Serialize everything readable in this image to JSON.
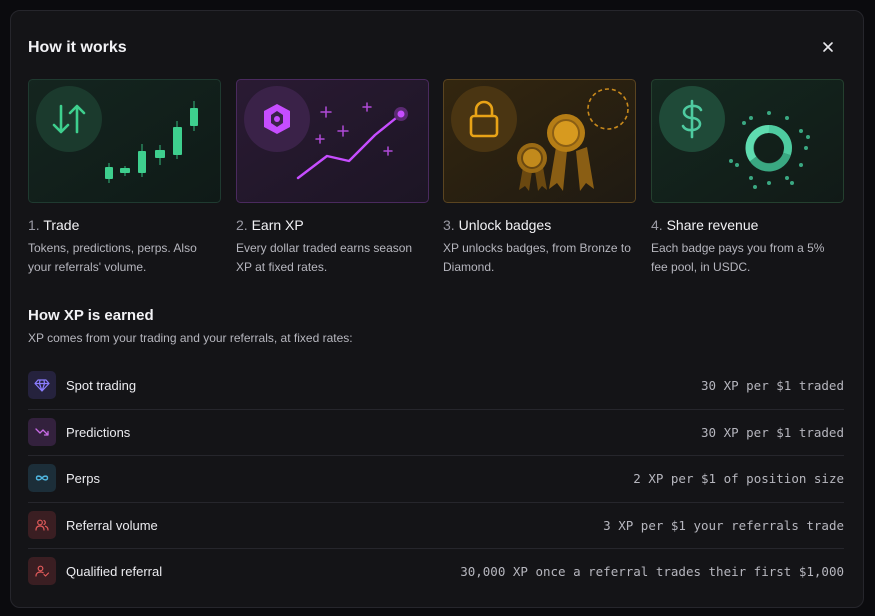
{
  "modal": {
    "title": "How it works",
    "close_icon": "close-icon"
  },
  "steps": [
    {
      "number": "1.",
      "title": "Trade",
      "description": "Tokens, predictions, perps. Also your referrals' volume.",
      "icon": "swap-arrows-icon",
      "accent": "#3ecf8e"
    },
    {
      "number": "2.",
      "title": "Earn XP",
      "description": "Every dollar traded earns season XP at fixed rates.",
      "icon": "gem-icon",
      "accent": "#c64dff"
    },
    {
      "number": "3.",
      "title": "Unlock badges",
      "description": "XP unlocks badges, from Bronze to Diamond.",
      "icon": "lock-icon",
      "accent": "#e8a317"
    },
    {
      "number": "4.",
      "title": "Share revenue",
      "description": "Each badge pays you from a 5% fee pool, in USDC.",
      "icon": "dollar-icon",
      "accent": "#4ecba0"
    }
  ],
  "xp_section": {
    "title": "How XP is earned",
    "subtitle": "XP comes from your trading and your referrals, at fixed rates:",
    "rows": [
      {
        "label": "Spot trading",
        "rate": "30 XP per $1 traded",
        "icon": "diamond-icon",
        "color": "#8b7dff",
        "bg": "#25223d"
      },
      {
        "label": "Predictions",
        "rate": "30 XP per $1 traded",
        "icon": "trend-icon",
        "color": "#c86be6",
        "bg": "#33213d"
      },
      {
        "label": "Perps",
        "rate": "2 XP per $1 of position size",
        "icon": "infinity-icon",
        "color": "#4fb6e0",
        "bg": "#1c2e39"
      },
      {
        "label": "Referral volume",
        "rate": "3 XP per $1 your referrals trade",
        "icon": "users-icon",
        "color": "#e05a5a",
        "bg": "#3a1e22"
      },
      {
        "label": "Qualified referral",
        "rate": "30,000 XP once a referral trades their first $1,000",
        "icon": "user-check-icon",
        "color": "#e05a5a",
        "bg": "#3a1e22"
      }
    ]
  }
}
